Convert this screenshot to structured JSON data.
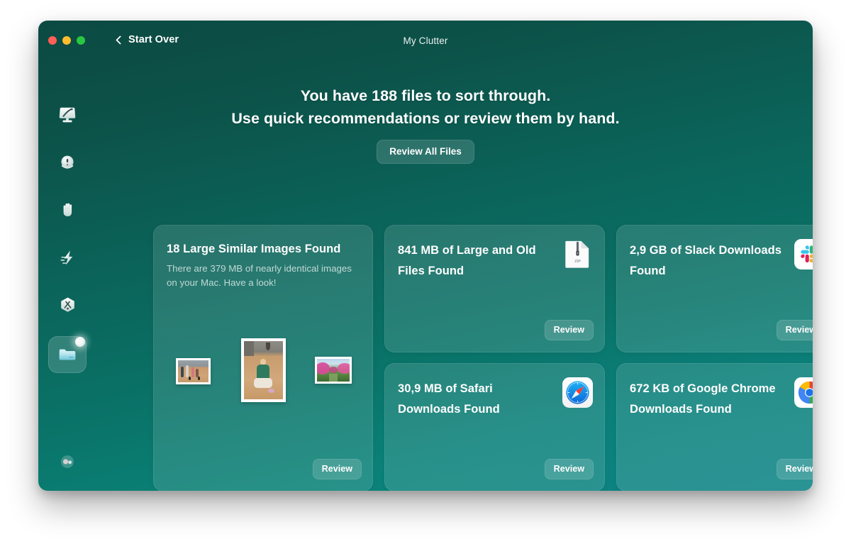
{
  "window": {
    "title": "My Clutter",
    "back_label": "Start Over",
    "traffic_lights": [
      "close",
      "minimize",
      "zoom"
    ]
  },
  "headline": {
    "line1": "You have 188 files to sort through.",
    "line2": "Use quick recommendations or review them by hand.",
    "file_count": "188",
    "cta_label": "Review All Files"
  },
  "sidebar": {
    "items": [
      {
        "icon": "smart-scan-icon",
        "active": false
      },
      {
        "icon": "privacy-sphere-icon",
        "active": false
      },
      {
        "icon": "protection-hand-icon",
        "active": false
      },
      {
        "icon": "performance-bolt-icon",
        "active": false
      },
      {
        "icon": "applications-hex-icon",
        "active": false
      },
      {
        "icon": "my-clutter-folder-icon",
        "active": true,
        "badge": true
      }
    ],
    "account": {
      "icon": "account-avatar-icon"
    }
  },
  "cards": [
    {
      "id": "large-similar-images",
      "title": "18 Large Similar Images Found",
      "subtitle": "There are 379 MB of nearly identical images on your Mac. Have a look!",
      "count": "18",
      "size": "379 MB",
      "review_label": "Review",
      "thumbnails": [
        "people-dogs-photo",
        "person-green-photo",
        "pink-garden-photo"
      ]
    },
    {
      "id": "large-and-old-files",
      "title": "841 MB of Large and Old Files Found",
      "size": "841 MB",
      "icon": "zip-file-icon",
      "review_label": "Review"
    },
    {
      "id": "slack-downloads",
      "title": "2,9 GB of Slack Downloads Found",
      "size": "2,9 GB",
      "icon": "slack-icon",
      "review_label": "Review"
    },
    {
      "id": "safari-downloads",
      "title": "30,9 MB of Safari Downloads Found",
      "size": "30,9 MB",
      "icon": "safari-icon",
      "review_label": "Review"
    },
    {
      "id": "chrome-downloads",
      "title": "672 KB of Google Chrome Downloads Found",
      "size": "672 KB",
      "icon": "chrome-icon",
      "review_label": "Review"
    }
  ],
  "colors": {
    "bg_top": "#0b4a42",
    "bg_bottom": "#0a8277",
    "card_fill": "rgba(255,255,255,0.12)",
    "text_primary": "#ffffff",
    "text_secondary": "rgba(255,255,255,0.70)",
    "traffic_red": "#ff5f57",
    "traffic_yellow": "#febc2e",
    "traffic_green": "#28c840"
  }
}
